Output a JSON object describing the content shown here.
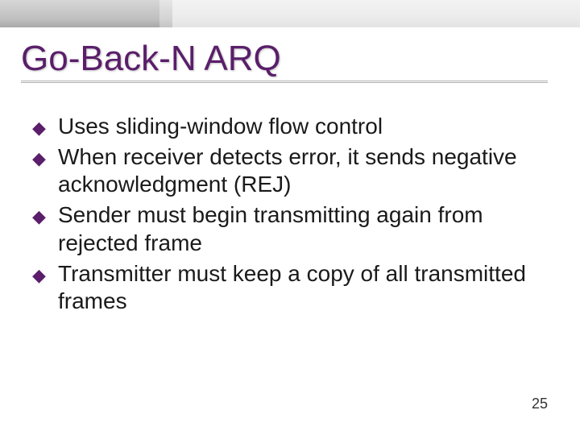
{
  "slide": {
    "title": "Go-Back-N ARQ",
    "bullets": [
      "Uses sliding-window flow control",
      "When receiver detects error, it sends negative acknowledgment (REJ)",
      "Sender must begin transmitting again from rejected frame",
      "Transmitter must keep a copy of all transmitted frames"
    ],
    "page_number": "25",
    "bullet_glyph": "◆",
    "colors": {
      "title": "#5a1e6a",
      "bullet": "#5a1e6a"
    }
  }
}
